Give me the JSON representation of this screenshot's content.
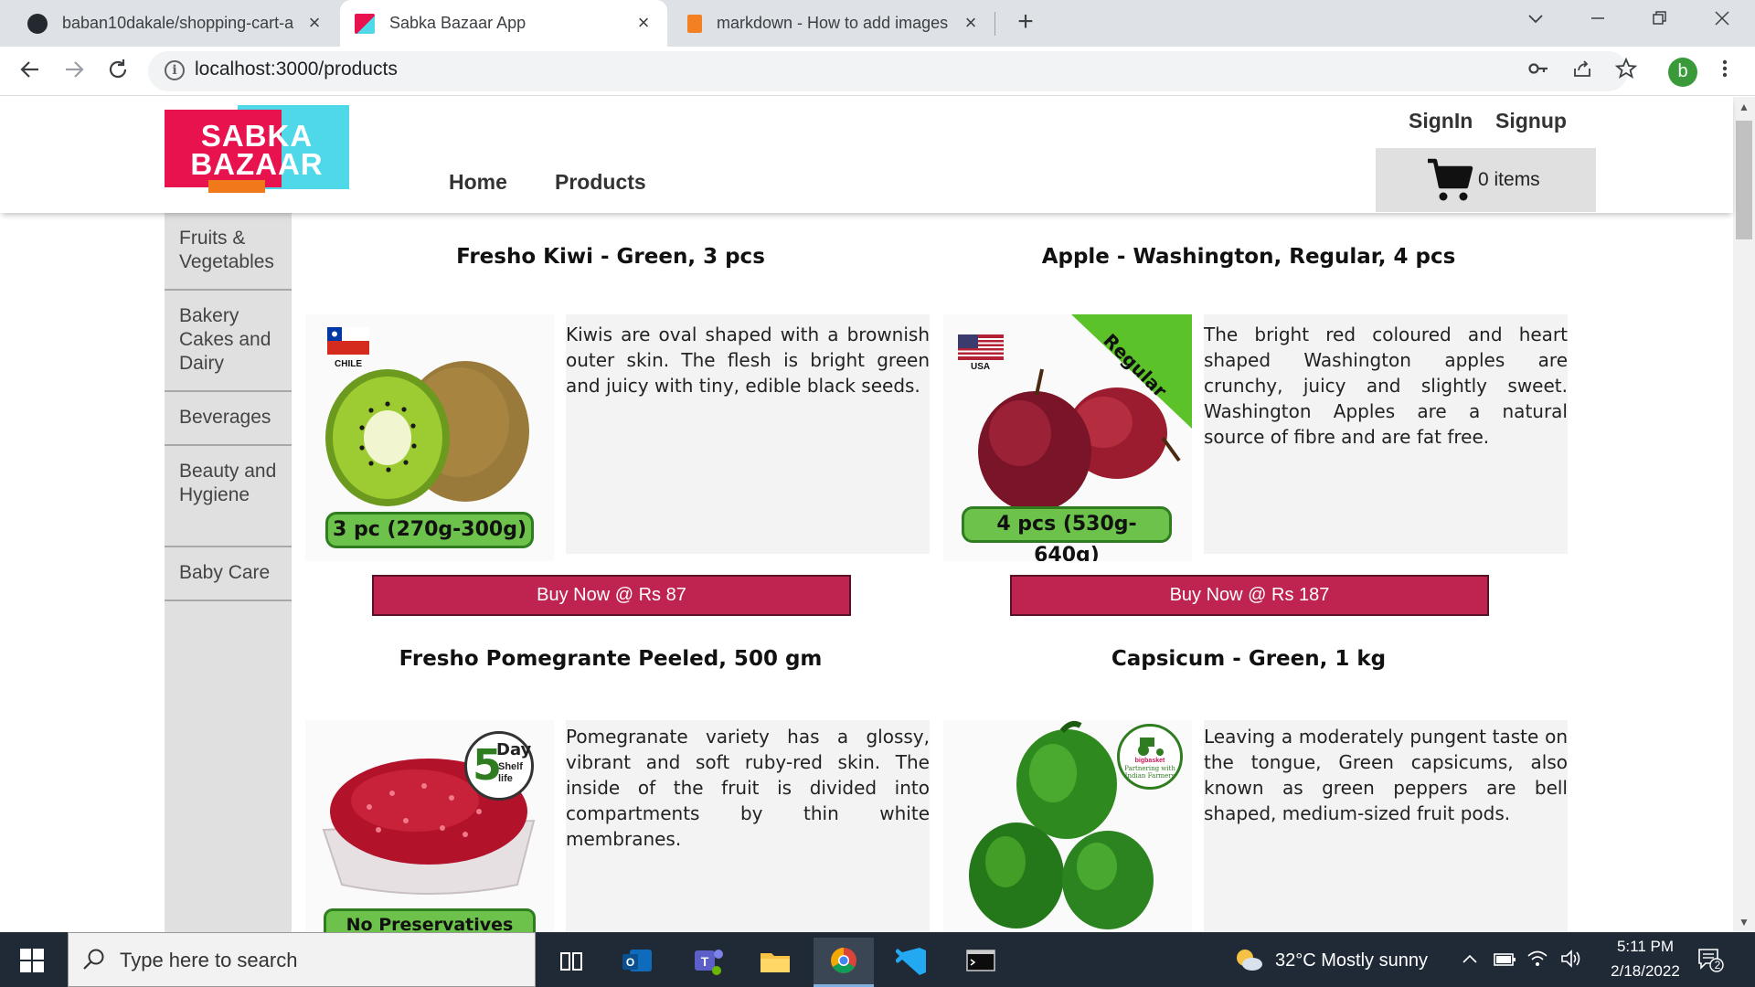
{
  "browser": {
    "tabs": [
      {
        "title": "baban10dakale/shopping-cart-a",
        "active": false
      },
      {
        "title": "Sabka Bazaar App",
        "active": true
      },
      {
        "title": "markdown - How to add images",
        "active": false
      }
    ],
    "url": "localhost:3000/products",
    "profile_initial": "b"
  },
  "site": {
    "logo_text": "SABKA BAZAAR",
    "nav": {
      "home": "Home",
      "products": "Products"
    },
    "auth": {
      "signin": "SignIn",
      "signup": "Signup"
    },
    "cart": {
      "count_label": "0 items"
    }
  },
  "sidebar": {
    "items": [
      {
        "label": "Fruits & Vegetables"
      },
      {
        "label": "Bakery Cakes and Dairy"
      },
      {
        "label": "Beverages"
      },
      {
        "label": "Beauty and Hygiene"
      },
      {
        "label": "Baby Care"
      }
    ]
  },
  "products": [
    {
      "title": "Fresho Kiwi - Green, 3 pcs",
      "description": "Kiwis are oval shaped with a brownish outer skin. The flesh is bright green and juicy with tiny, edible black seeds.",
      "buy_label": "Buy Now @ Rs 87",
      "badge": "3 pc (270g-300g)",
      "origin": "CHILE"
    },
    {
      "title": "Apple - Washington, Regular, 4 pcs",
      "description": "The bright red coloured and heart shaped Washington apples are crunchy, juicy and slightly sweet. Washington Apples are a natural source of fibre and are fat free.",
      "buy_label": "Buy Now @ Rs 187",
      "badge": "4 pcs (530g-640g)",
      "origin": "USA",
      "ribbon": "Regular"
    },
    {
      "title": "Fresho Pomegrante Peeled, 500 gm",
      "description": "Pomegranate variety has a glossy, vibrant and soft ruby-red skin. The inside of the fruit is divided into compartments by thin white membranes.",
      "badge": "No Preservatives",
      "shelf_number": "5",
      "shelf_line1": "Day",
      "shelf_line2": "Shelf",
      "shelf_line3": "life"
    },
    {
      "title": "Capsicum - Green, 1 kg",
      "description": "Leaving a moderately pungent taste on the tongue, Green capsicums, also known as green peppers are bell shaped, medium-sized fruit pods.",
      "seal_line1": "bigbasket",
      "seal_line2": "Partnering with",
      "seal_line3": "Indian Farmers"
    }
  ],
  "taskbar": {
    "search_placeholder": "Type here to search",
    "weather": "32°C  Mostly sunny",
    "time": "5:11 PM",
    "date": "2/18/2022",
    "notifications": "2"
  },
  "colors": {
    "brand_pink": "#e8124f",
    "brand_cyan": "#4fd8e8",
    "buy_button": "#bf2350",
    "badge_green": "#6cc24a"
  }
}
